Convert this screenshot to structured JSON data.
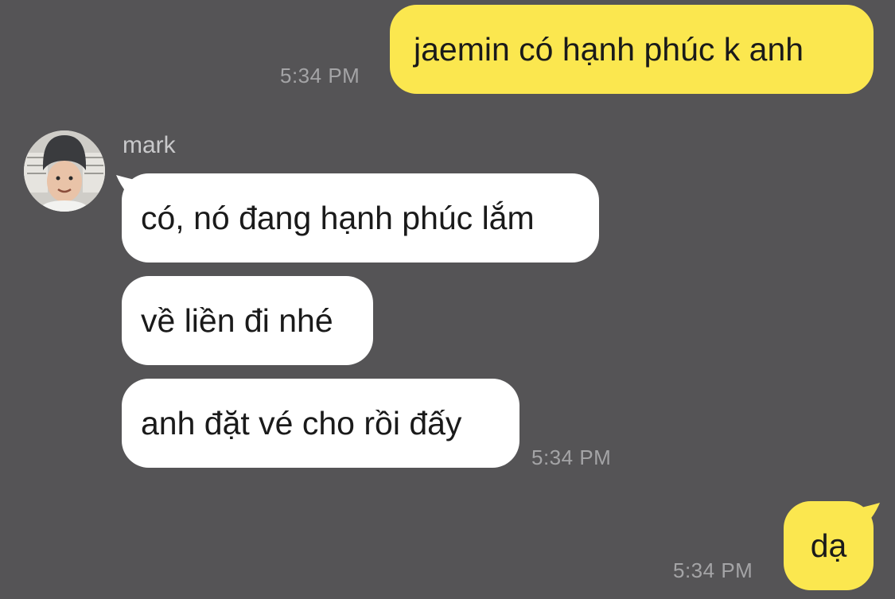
{
  "colors": {
    "background": "#555456",
    "outgoing_bubble": "#fbe74f",
    "incoming_bubble": "#ffffff",
    "timestamp": "#a4a4a6",
    "sender_name": "#c9c9cb"
  },
  "messages": {
    "m1": {
      "text": "jaemin có hạnh phúc k anh",
      "time": "5:34 PM"
    },
    "sender": {
      "name": "mark",
      "avatar_icon": "user-avatar-photo"
    },
    "m2": {
      "text": "có, nó đang hạnh phúc lắm"
    },
    "m3": {
      "text": "về liền đi nhé"
    },
    "m4": {
      "text": "anh đặt vé cho rồi đấy",
      "time": "5:34 PM"
    },
    "m5": {
      "text": "dạ",
      "time": "5:34 PM"
    }
  }
}
